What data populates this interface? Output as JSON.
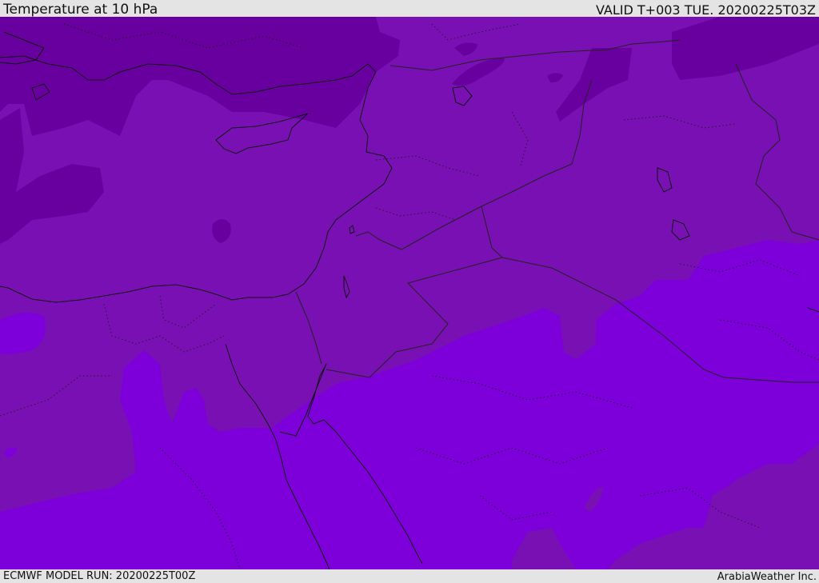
{
  "header": {
    "title": "Temperature at 10 hPa",
    "valid": "VALID T+003 TUE. 20200225T03Z"
  },
  "footer": {
    "model_run": "ECMWF MODEL RUN: 20200225T00Z",
    "credit": "ArabiaWeather Inc."
  },
  "map": {
    "colors": {
      "band_cold": "#6800a0",
      "band_mid": "#7810b4",
      "band_warm": "#7d00da",
      "coastline": "#111111",
      "border": "#222222"
    }
  }
}
